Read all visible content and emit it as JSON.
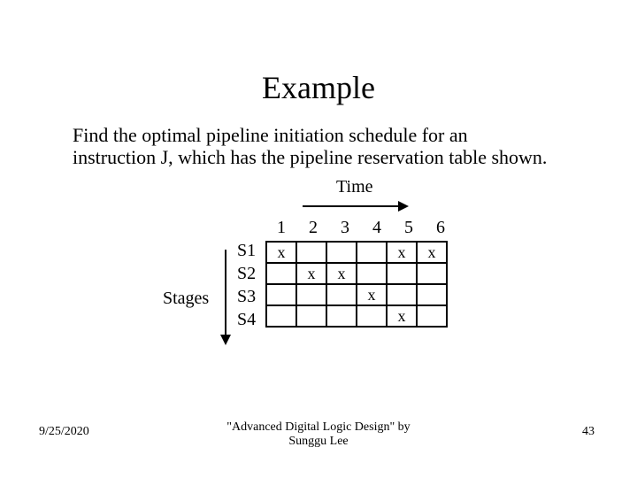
{
  "title": "Example",
  "body_line1": "Find the optimal pipeline initiation schedule for an",
  "body_line2": "instruction J, which has the pipeline reservation table shown.",
  "footer": {
    "date": "9/25/2020",
    "center_line1": "\"Advanced Digital Logic Design\" by",
    "center_line2": "Sunggu Lee",
    "page": "43"
  },
  "diagram": {
    "time_label": "Time",
    "stages_label": "Stages",
    "row_labels": [
      "S1",
      "S2",
      "S3",
      "S4"
    ],
    "col_headers": [
      "1",
      "2",
      "3",
      "4",
      "5",
      "6"
    ],
    "mark": "x"
  },
  "chart_data": {
    "type": "table",
    "title": "Pipeline reservation table",
    "xlabel": "Time",
    "ylabel": "Stages",
    "categories": [
      "1",
      "2",
      "3",
      "4",
      "5",
      "6"
    ],
    "rows": [
      "S1",
      "S2",
      "S3",
      "S4"
    ],
    "grid": [
      [
        "x",
        "",
        "",
        "",
        "x",
        "x"
      ],
      [
        "",
        "x",
        "x",
        "",
        "",
        ""
      ],
      [
        "",
        "",
        "",
        "x",
        "",
        ""
      ],
      [
        "",
        "",
        "",
        "",
        "x",
        ""
      ]
    ]
  }
}
